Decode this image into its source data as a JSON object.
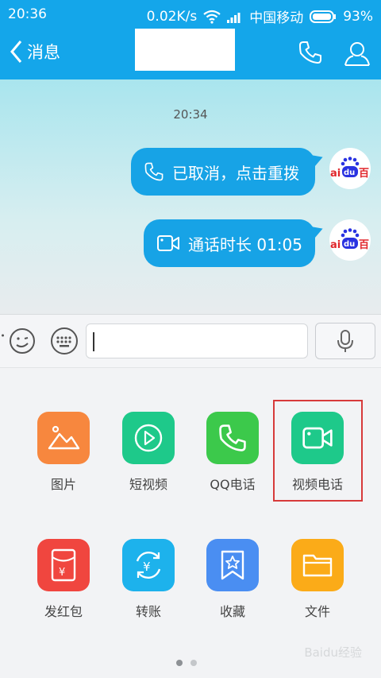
{
  "status_bar": {
    "time": "20:36",
    "speed": "0.02K/s",
    "carrier": "中国移动",
    "battery": "93%"
  },
  "header": {
    "back_label": "消息",
    "title": ""
  },
  "chat": {
    "timestamp": "20:34",
    "messages": [
      {
        "text": "已取消，点击重拨",
        "icon": "phone-icon"
      },
      {
        "text": "通话时长 01:05",
        "icon": "video-camera-icon"
      }
    ],
    "avatar_text": "百度"
  },
  "input": {
    "value": ""
  },
  "tools": [
    {
      "label": "图片",
      "icon": "image-icon",
      "color": "#f7873e"
    },
    {
      "label": "短视频",
      "icon": "play-icon",
      "color": "#1ec98a"
    },
    {
      "label": "QQ电话",
      "icon": "phone-icon",
      "color": "#3cc94b"
    },
    {
      "label": "视频电话",
      "icon": "video-camera-icon",
      "color": "#1ec98a"
    },
    {
      "label": "发红包",
      "icon": "red-packet-icon",
      "color": "#f0463f"
    },
    {
      "label": "转账",
      "icon": "transfer-icon",
      "color": "#1db2ec"
    },
    {
      "label": "收藏",
      "icon": "favorite-icon",
      "color": "#4a8ef2"
    },
    {
      "label": "文件",
      "icon": "folder-icon",
      "color": "#fbab18"
    }
  ],
  "watermark": "Baidu经验",
  "colors": {
    "header": "#14a6ea",
    "bubble": "#17a3e6",
    "highlight": "#d73a3a"
  }
}
